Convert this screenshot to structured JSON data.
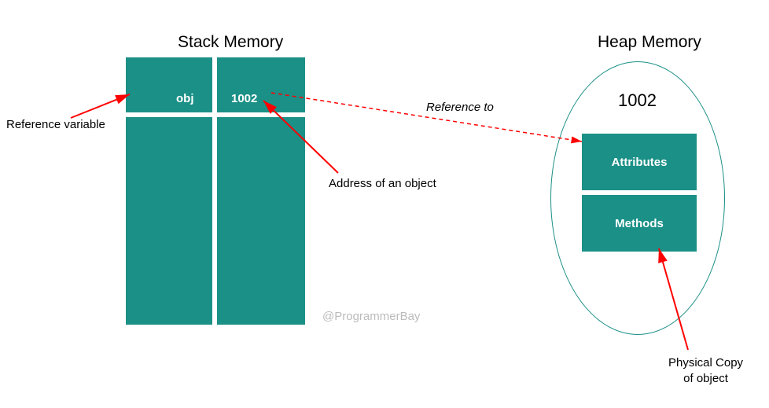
{
  "titles": {
    "stack": "Stack Memory",
    "heap": "Heap Memory"
  },
  "stack": {
    "var_name": "obj",
    "address": "1002"
  },
  "annotations": {
    "reference_variable": "Reference variable",
    "address_of_object": "Address of an object",
    "reference_to": "Reference to",
    "physical_copy_line1": "Physical Copy",
    "physical_copy_line2": "of object"
  },
  "heap": {
    "address": "1002",
    "attributes_label": "Attributes",
    "methods_label": "Methods"
  },
  "watermark": "@ProgrammerBay",
  "colors": {
    "teal": "#1b9087",
    "red": "#ff0000"
  }
}
